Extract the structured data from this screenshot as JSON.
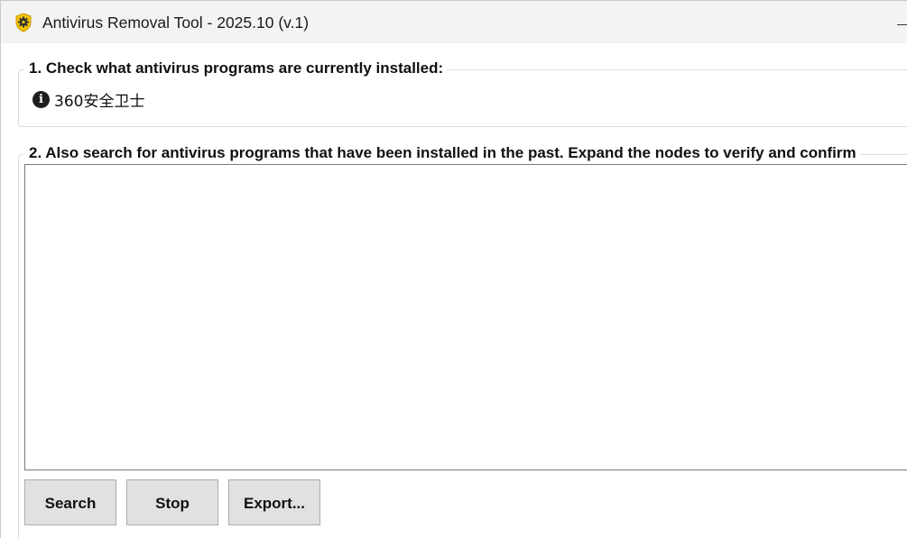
{
  "window": {
    "title": "Antivirus Removal Tool - 2025.10 (v.1)",
    "icon": "shield-gear-icon",
    "accent_color": "#f5c400"
  },
  "section1": {
    "legend": "1. Check what antivirus programs are currently installed:",
    "items": [
      {
        "icon": "info-icon",
        "icon_glyph": "i",
        "label": "360安全卫士"
      }
    ]
  },
  "section2": {
    "legend": "2. Also search for antivirus programs that have been installed in the past. Expand the nodes to verify and confirm",
    "tree_items": []
  },
  "buttons": {
    "search": "Search",
    "stop": "Stop",
    "export": "Export..."
  }
}
